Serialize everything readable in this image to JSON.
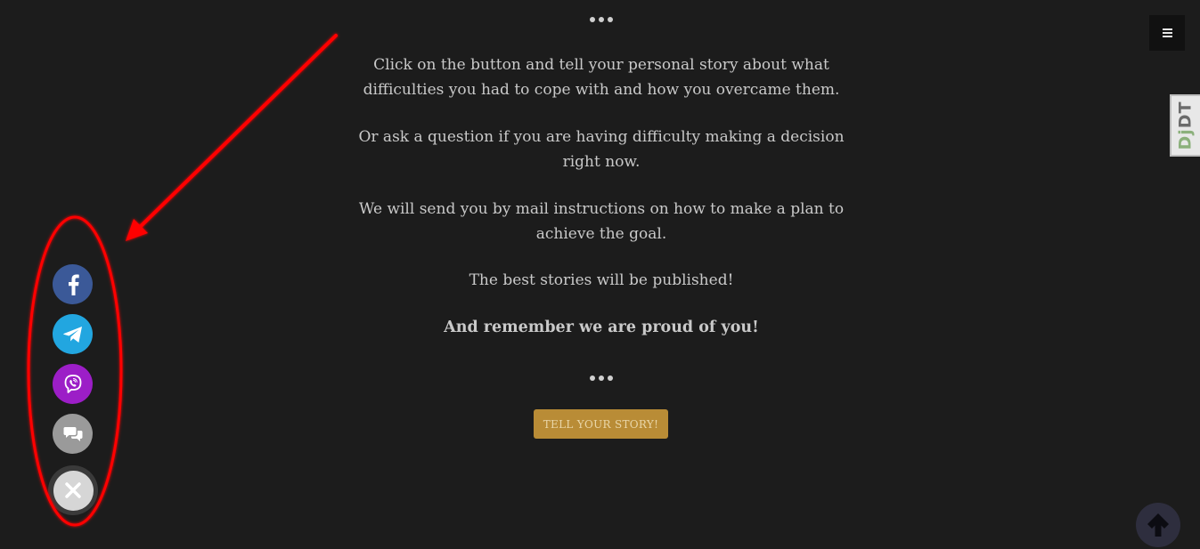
{
  "content": {
    "paragraphs": [
      "Click on the button and tell your personal story about what difficulties you had to cope with and how you overcame them.",
      "Or ask a question if you are having difficulty making a decision right now.",
      "We will send you by mail instructions on how to make a plan to achieve the goal.",
      "The best stories will be published!"
    ],
    "emphasis": "And remember we are proud of you!",
    "cta_label": "TELL YOUR STORY!"
  },
  "debug_toolbar": {
    "prefix": "Dj",
    "suffix": "DT"
  },
  "share_buttons": {
    "items": [
      {
        "name": "facebook",
        "icon": "facebook-icon",
        "color": "#3b5998"
      },
      {
        "name": "telegram",
        "icon": "telegram-icon",
        "color": "#22a6e0"
      },
      {
        "name": "viber",
        "icon": "viber-icon",
        "color": "#9c1ec7"
      },
      {
        "name": "chat",
        "icon": "chat-icon",
        "color": "#9a9a9a"
      },
      {
        "name": "close",
        "icon": "close-icon",
        "color": "#d6d6d6"
      }
    ]
  },
  "colors": {
    "background": "#1c1c1c",
    "text": "#c9c9c9",
    "cta": "#b98c36",
    "annotation": "#ff0000"
  },
  "icons": {
    "menu": "hamburger-menu-icon",
    "scroll_top": "arrow-up-icon"
  }
}
